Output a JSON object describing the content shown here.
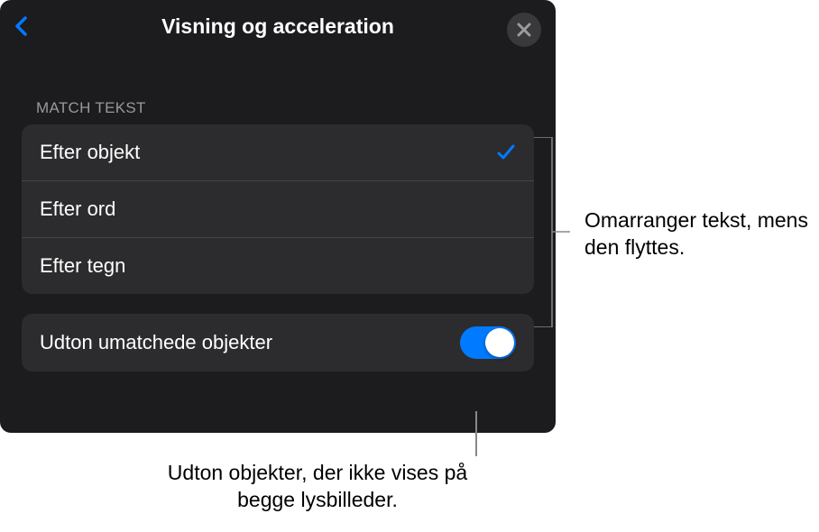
{
  "header": {
    "title": "Visning og acceleration"
  },
  "section": {
    "header": "MATCH TEKST"
  },
  "options": [
    {
      "label": "Efter objekt",
      "selected": true
    },
    {
      "label": "Efter ord",
      "selected": false
    },
    {
      "label": "Efter tegn",
      "selected": false
    }
  ],
  "toggle": {
    "label": "Udton umatchede objekter",
    "on": true
  },
  "callouts": {
    "right": "Omarranger tekst, mens den flyttes.",
    "bottom": "Udton objekter, der ikke vises på begge lysbilleder."
  }
}
